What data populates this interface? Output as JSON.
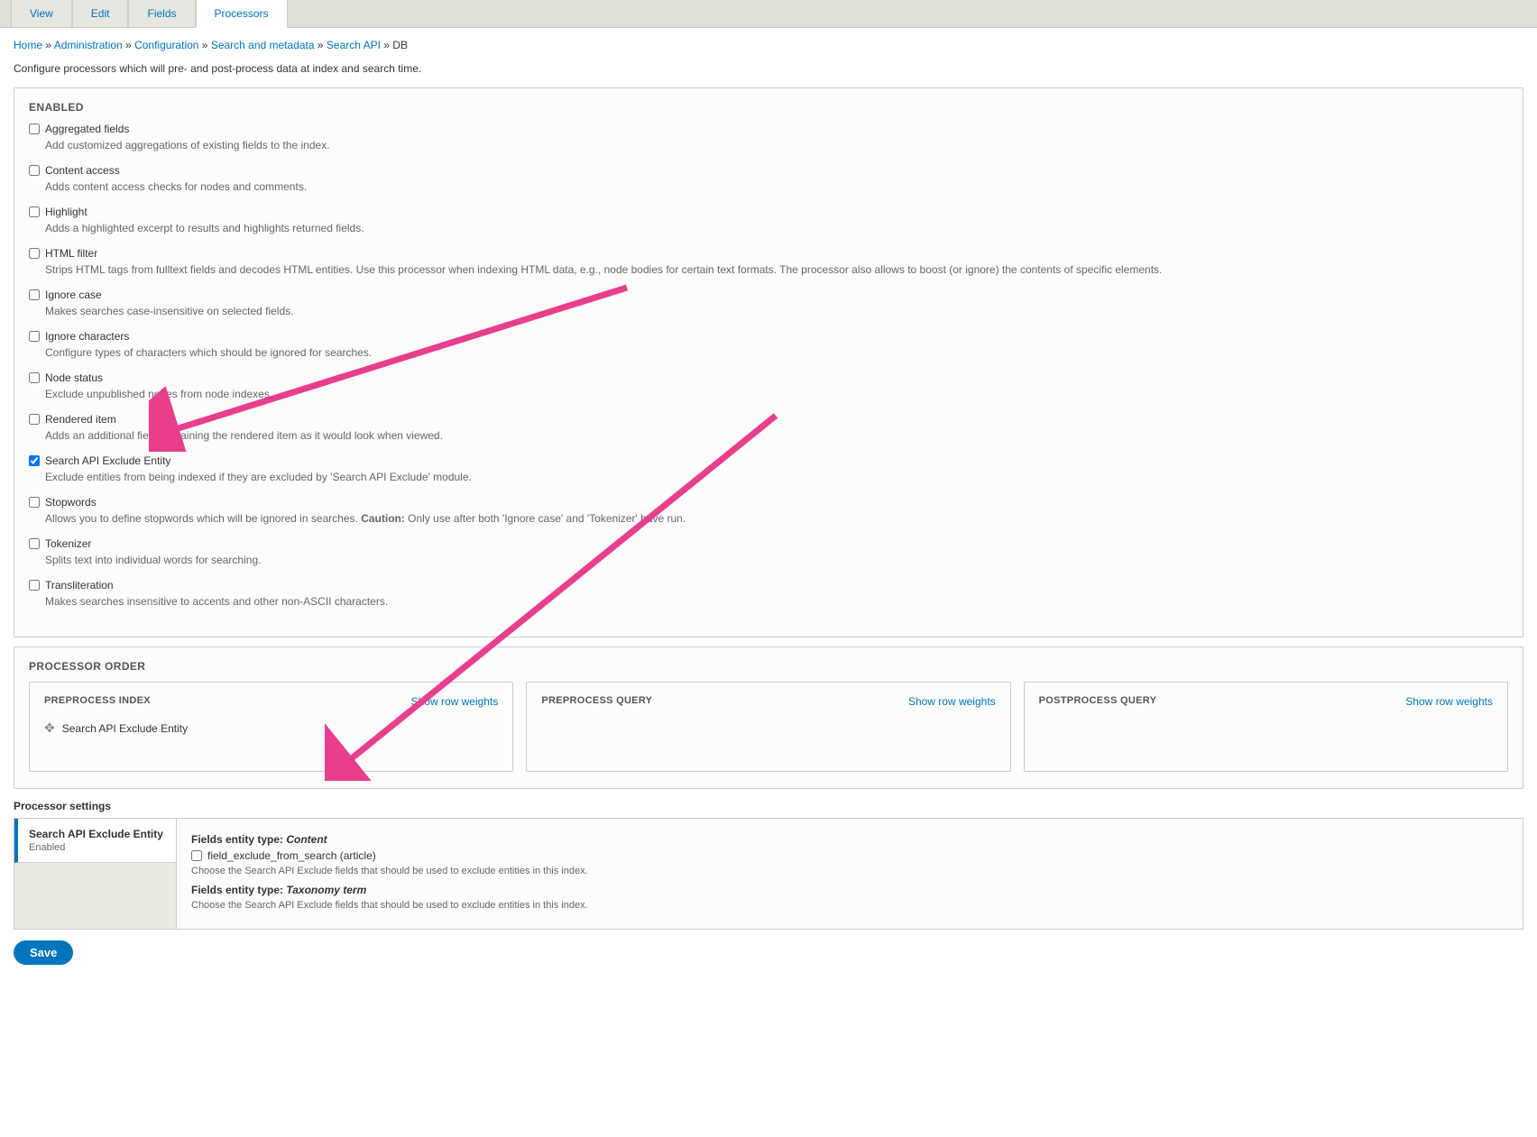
{
  "tabs": {
    "view": "View",
    "edit": "Edit",
    "fields": "Fields",
    "processors": "Processors"
  },
  "breadcrumb": {
    "home": "Home",
    "admin": "Administration",
    "config": "Configuration",
    "search_meta": "Search and metadata",
    "search_api": "Search API",
    "db": "DB",
    "sep": " » "
  },
  "intro": "Configure processors which will pre- and post-process data at index and search time.",
  "enabled": {
    "legend": "ENABLED",
    "items": [
      {
        "label": "Aggregated fields",
        "checked": false,
        "desc": "Add customized aggregations of existing fields to the index."
      },
      {
        "label": "Content access",
        "checked": false,
        "desc": "Adds content access checks for nodes and comments."
      },
      {
        "label": "Highlight",
        "checked": false,
        "desc": "Adds a highlighted excerpt to results and highlights returned fields."
      },
      {
        "label": "HTML filter",
        "checked": false,
        "desc": "Strips HTML tags from fulltext fields and decodes HTML entities. Use this processor when indexing HTML data, e.g., node bodies for certain text formats. The processor also allows to boost (or ignore) the contents of specific elements."
      },
      {
        "label": "Ignore case",
        "checked": false,
        "desc": "Makes searches case-insensitive on selected fields."
      },
      {
        "label": "Ignore characters",
        "checked": false,
        "desc": "Configure types of characters which should be ignored for searches."
      },
      {
        "label": "Node status",
        "checked": false,
        "desc": "Exclude unpublished nodes from node indexes."
      },
      {
        "label": "Rendered item",
        "checked": false,
        "desc": "Adds an additional field containing the rendered item as it would look when viewed."
      },
      {
        "label": "Search API Exclude Entity",
        "checked": true,
        "desc": "Exclude entities from being indexed if they are excluded by 'Search API Exclude' module."
      },
      {
        "label": "Stopwords",
        "checked": false,
        "desc_pre": "Allows you to define stopwords which will be ignored in searches. ",
        "caution_label": "Caution:",
        "desc_post": " Only use after both 'Ignore case' and 'Tokenizer' have run."
      },
      {
        "label": "Tokenizer",
        "checked": false,
        "desc": "Splits text into individual words for searching."
      },
      {
        "label": "Transliteration",
        "checked": false,
        "desc": "Makes searches insensitive to accents and other non-ASCII characters."
      }
    ]
  },
  "order": {
    "legend": "PROCESSOR ORDER",
    "show_weights": "Show row weights",
    "cols": {
      "pre_index": {
        "title": "PREPROCESS INDEX",
        "item": "Search API Exclude Entity"
      },
      "pre_query": {
        "title": "PREPROCESS QUERY"
      },
      "post_query": {
        "title": "POSTPROCESS QUERY"
      }
    }
  },
  "settings": {
    "title": "Processor settings",
    "vtab_title": "Search API Exclude Entity",
    "vtab_sub": "Enabled",
    "content": {
      "field1_label_pre": "Fields entity type: ",
      "field1_label_em": "Content",
      "cb_label": "field_exclude_from_search (article)",
      "help1": "Choose the Search API Exclude fields that should be used to exclude entities in this index.",
      "field2_label_pre": "Fields entity type: ",
      "field2_label_em": "Taxonomy term",
      "help2": "Choose the Search API Exclude fields that should be used to exclude entities in this index."
    }
  },
  "save": "Save"
}
